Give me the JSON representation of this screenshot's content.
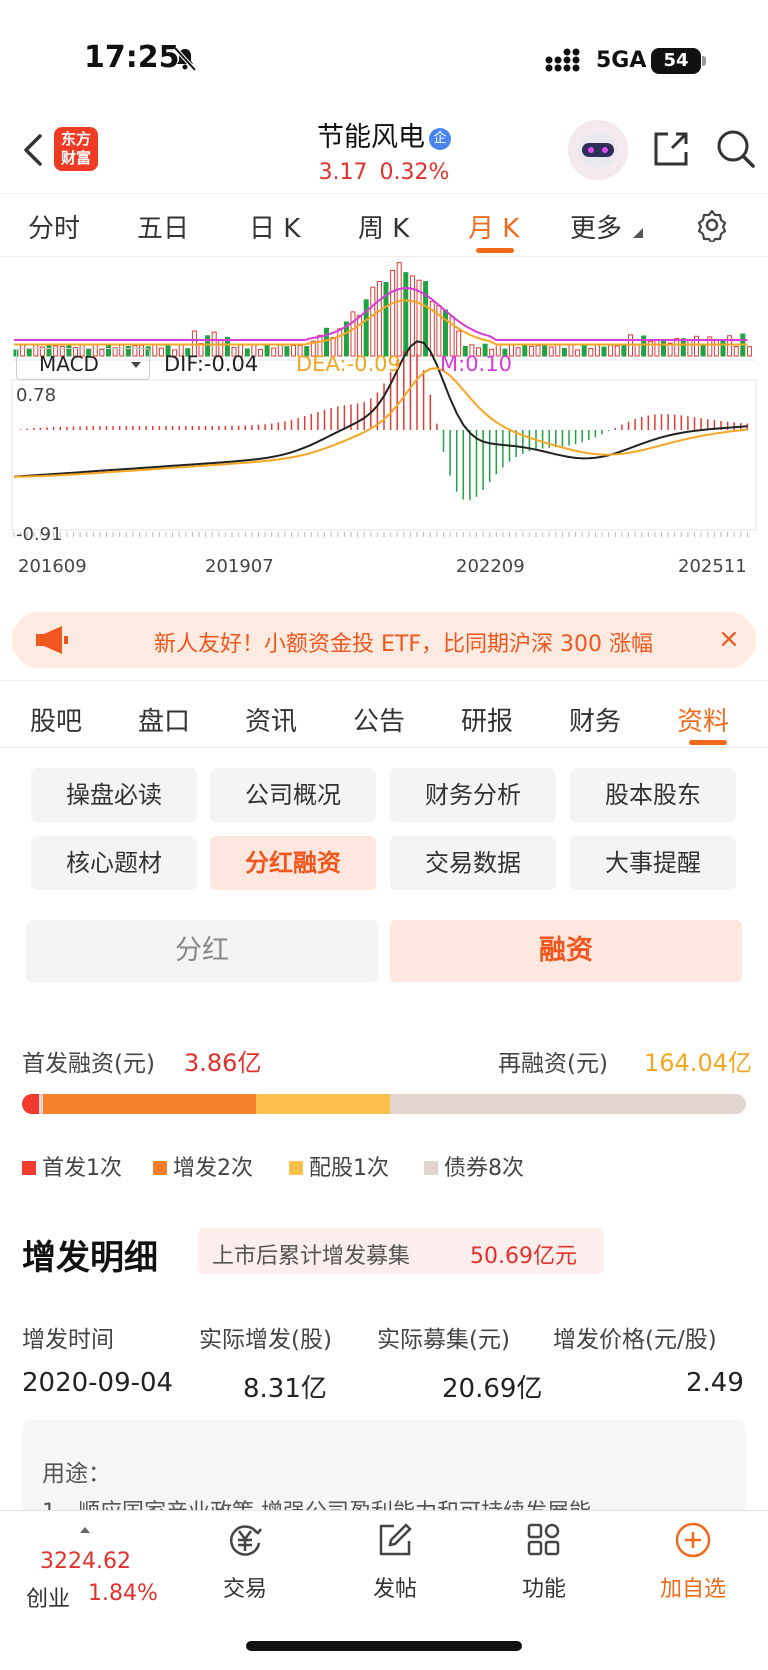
{
  "status_bar": {
    "time": "17:25",
    "network": "5GA",
    "battery": "54"
  },
  "header": {
    "logo_line1": "东方",
    "logo_line2": "财富",
    "stock_name": "节能风电",
    "badge": "企",
    "price": "3.17",
    "change_pct": "0.32%"
  },
  "kline_tabs": {
    "items": [
      "分时",
      "五日",
      "日 K",
      "周 K",
      "月 K",
      "更多"
    ],
    "active": "月 K"
  },
  "chart": {
    "indicator_select": "MACD",
    "dif": "DIF:-0.04",
    "dea": "DEA:-0.09",
    "m": "M:0.10",
    "macd_max": "0.78",
    "macd_min": "-0.91",
    "x_ticks": [
      "201609",
      "201907",
      "202209",
      "202511"
    ],
    "colors": {
      "up": "#e23a35",
      "down": "#1fa342",
      "dif": "#222222",
      "dea": "#f5a623",
      "m": "#d83bd8"
    }
  },
  "banner": {
    "text": "新人友好！小额资金投 ETF，比同期沪深 300 涨幅",
    "close": "×"
  },
  "info_tabs": {
    "items": [
      "股吧",
      "盘口",
      "资讯",
      "公告",
      "研报",
      "财务",
      "资料"
    ],
    "active": "资料"
  },
  "chips": [
    [
      "操盘必读",
      "公司概况",
      "财务分析",
      "股本股东"
    ],
    [
      "核心题材",
      "分红融资",
      "交易数据",
      "大事提醒"
    ]
  ],
  "active_chip": "分红融资",
  "segment": {
    "left": "分红",
    "right": "融资",
    "active": "融资"
  },
  "financing": {
    "first_label": "首发融资(元)",
    "first_value": "3.86亿",
    "re_label": "再融资(元)",
    "re_value": "164.04亿",
    "bar_fractions": {
      "首发": 0.023,
      "增发": 0.3,
      "配股": 0.185,
      "债券": 0.492
    },
    "legend": [
      {
        "label": "首发1次",
        "color": "#f23a2e"
      },
      {
        "label": "增发2次",
        "color": "#f5822a"
      },
      {
        "label": "配股1次",
        "color": "#fbbf4e"
      },
      {
        "label": "债券8次",
        "color": "#e2d4cf"
      }
    ]
  },
  "detail": {
    "title": "增发明细",
    "pill_label": "上市后累计增发募集",
    "pill_value": "50.69亿元",
    "headers": [
      "增发时间",
      "实际增发(股)",
      "实际募集(元)",
      "增发价格(元/股)"
    ],
    "row": [
      "2020-09-04",
      "8.31亿",
      "20.69亿",
      "2.49"
    ],
    "usage_label": "用途：",
    "usage_text": "1、顺应国家产业政策,增强公司盈利能力和可持续发展能"
  },
  "bottom_nav": {
    "index_value": "3224.62",
    "index_name": "创业",
    "index_pct": "1.84%",
    "items": [
      "交易",
      "发帖",
      "功能",
      "加自选"
    ]
  }
}
